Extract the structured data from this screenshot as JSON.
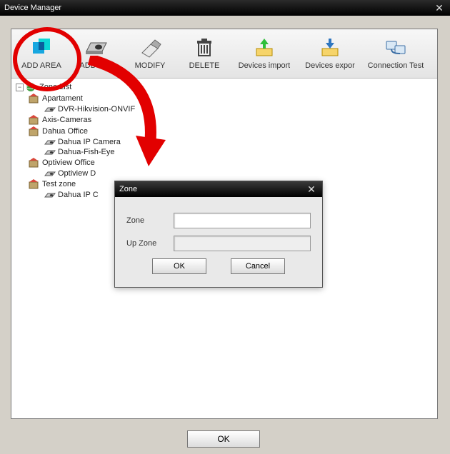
{
  "window": {
    "title": "Device Manager"
  },
  "toolbar": {
    "add_area": "ADD AREA",
    "add_device": "ADD D…",
    "modify": "MODIFY",
    "delete": "DELETE",
    "devices_import": "Devices import",
    "devices_export": "Devices expor",
    "connection_test": "Connection Test"
  },
  "tree": {
    "root": "Zone List",
    "nodes": [
      {
        "label": "Apartament",
        "children": [
          "DVR-Hikvision-ONVIF"
        ]
      },
      {
        "label": "Axis-Cameras",
        "children": []
      },
      {
        "label": "Dahua Office",
        "children": [
          "Dahua IP Camera",
          "Dahua-Fish-Eye"
        ]
      },
      {
        "label": "Optiview Office",
        "children": [
          "Optiview D"
        ]
      },
      {
        "label": "Test zone",
        "children": [
          "Dahua IP C"
        ]
      }
    ]
  },
  "modal": {
    "title": "Zone",
    "zone_label": "Zone",
    "upzone_label": "Up Zone",
    "zone_value": "",
    "upzone_value": "",
    "ok": "OK",
    "cancel": "Cancel"
  },
  "bottom": {
    "ok": "OK"
  },
  "colors": {
    "highlight": "#e20000"
  }
}
